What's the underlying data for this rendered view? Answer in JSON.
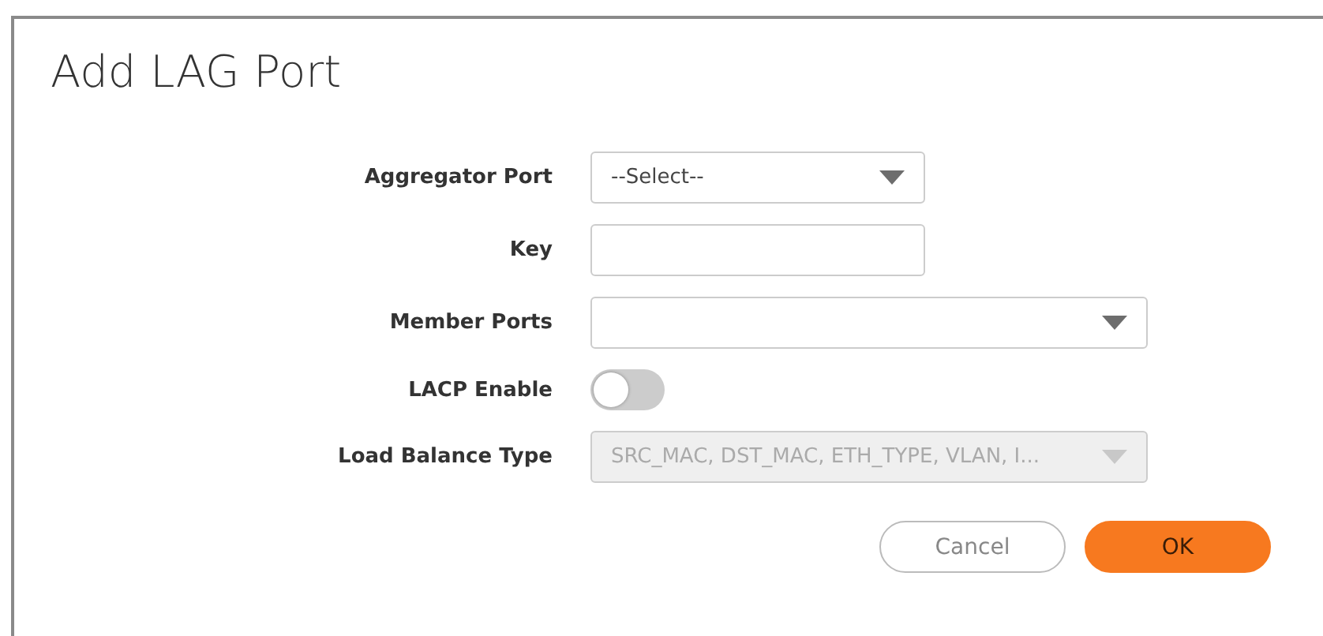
{
  "dialog": {
    "title": "Add LAG Port"
  },
  "fields": [
    {
      "label": "Aggregator Port",
      "kind": "select",
      "value": "--Select--",
      "wide": false,
      "disabled": false
    },
    {
      "label": "Key",
      "kind": "text",
      "wide": false,
      "disabled": false
    },
    {
      "label": "Member Ports",
      "kind": "select",
      "wide": true,
      "disabled": false
    },
    {
      "label": "LACP Enable",
      "kind": "toggle",
      "on": false
    },
    {
      "label": "Load Balance Type",
      "kind": "select",
      "value": "SRC_MAC, DST_MAC, ETH_TYPE, VLAN, I...",
      "wide": true,
      "disabled": true
    }
  ],
  "buttons": [
    {
      "label": "Cancel",
      "kind": "secondary"
    },
    {
      "label": "OK",
      "kind": "primary"
    }
  ]
}
